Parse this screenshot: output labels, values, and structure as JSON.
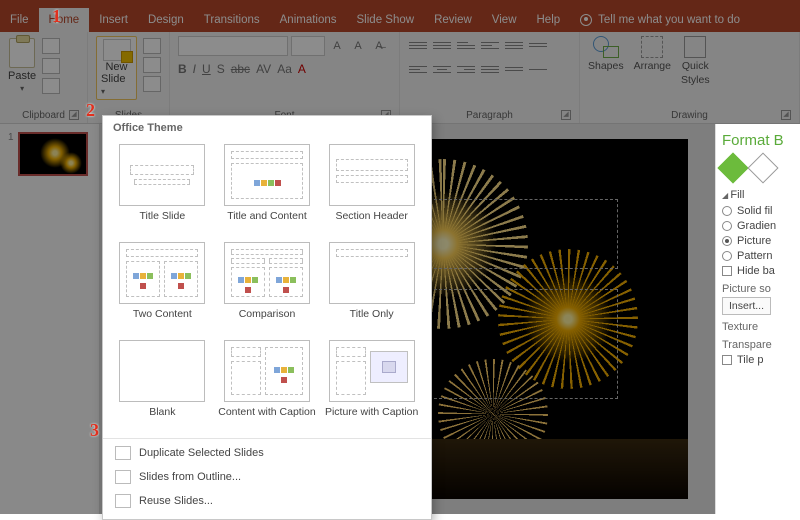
{
  "tabs": {
    "file": "File",
    "home": "Home",
    "insert": "Insert",
    "design": "Design",
    "transitions": "Transitions",
    "animations": "Animations",
    "slideshow": "Slide Show",
    "review": "Review",
    "view": "View",
    "help": "Help",
    "tell": "Tell me what you want to do"
  },
  "ribbon": {
    "clipboard": {
      "paste": "Paste",
      "group": "Clipboard"
    },
    "slides": {
      "newSlide": "New",
      "newSlide2": "Slide",
      "group": "Slides"
    },
    "font": {
      "group": "Font",
      "B": "B",
      "I": "I",
      "U": "U",
      "S": "S",
      "abc": "abc",
      "AV": "AV",
      "Aa": "Aa",
      "A": "A"
    },
    "paragraph": {
      "group": "Paragraph"
    },
    "drawing": {
      "shapes": "Shapes",
      "arrange": "Arrange",
      "quick": "Quick",
      "styles": "Styles",
      "group": "Drawing"
    }
  },
  "thumbs": {
    "n1": "1"
  },
  "nsPanel": {
    "head": "Office Theme",
    "layouts": [
      "Title Slide",
      "Title and Content",
      "Section Header",
      "Two Content",
      "Comparison",
      "Title Only",
      "Blank",
      "Content with Caption",
      "Picture with Caption"
    ],
    "menu": {
      "dup": "Duplicate Selected Slides",
      "outline": "Slides from Outline...",
      "reuse": "Reuse Slides..."
    }
  },
  "format": {
    "title": "Format B",
    "fill": "Fill",
    "opts": {
      "solid": "Solid fil",
      "gradient": "Gradien",
      "picture": "Picture",
      "pattern": "Pattern",
      "hide": "Hide ba"
    },
    "picsrc": "Picture so",
    "insert": "Insert...",
    "texture": "Texture",
    "transp": "Transpare",
    "tile": "Tile p"
  },
  "badges": {
    "b1": "1",
    "b2": "2",
    "b3": "3"
  }
}
